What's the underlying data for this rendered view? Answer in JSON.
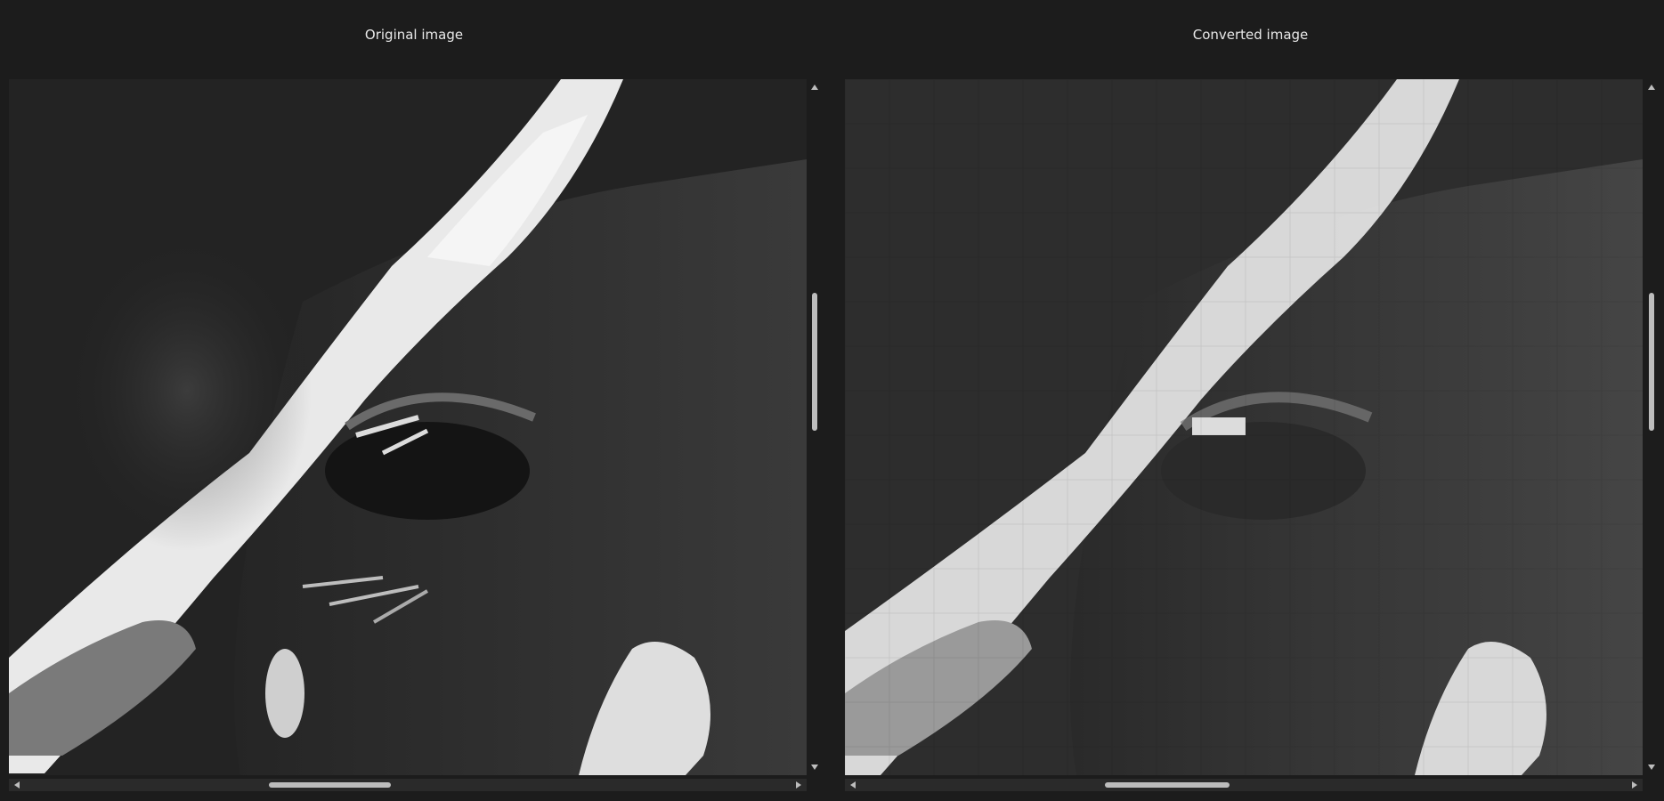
{
  "panes": {
    "left": {
      "title": "Original image"
    },
    "right": {
      "title": "Converted image"
    }
  },
  "icons": {
    "scroll_up": "arrow-up-icon",
    "scroll_down": "arrow-down-icon",
    "scroll_left": "arrow-left-icon",
    "scroll_right": "arrow-right-icon"
  },
  "colors": {
    "background": "#1c1c1c",
    "scrollbar_thumb": "#bdbdbd"
  }
}
